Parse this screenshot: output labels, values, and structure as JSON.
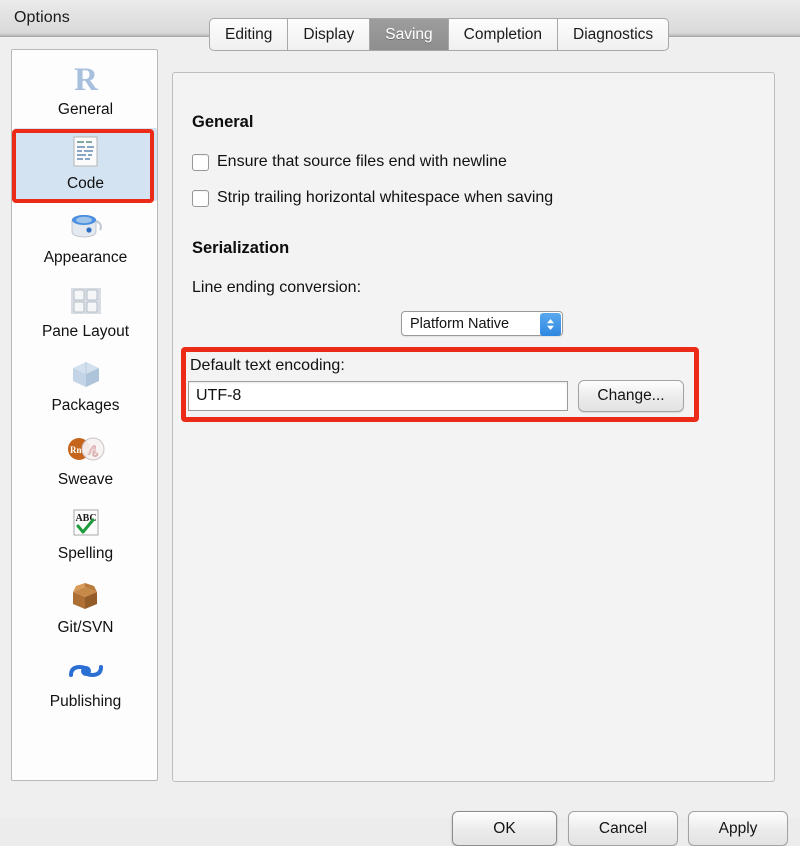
{
  "window": {
    "title": "Options"
  },
  "sidebar": {
    "items": [
      {
        "label": "General",
        "icon": "r-logo-icon",
        "selected": false
      },
      {
        "label": "Code",
        "icon": "code-file-icon",
        "selected": true
      },
      {
        "label": "Appearance",
        "icon": "paint-can-icon",
        "selected": false
      },
      {
        "label": "Pane Layout",
        "icon": "grid-panes-icon",
        "selected": false
      },
      {
        "label": "Packages",
        "icon": "box-icon",
        "selected": false
      },
      {
        "label": "Sweave",
        "icon": "rnw-pdf-icon",
        "selected": false
      },
      {
        "label": "Spelling",
        "icon": "abc-check-icon",
        "selected": false
      },
      {
        "label": "Git/SVN",
        "icon": "open-box-icon",
        "selected": false
      },
      {
        "label": "Publishing",
        "icon": "publish-icon",
        "selected": false
      }
    ]
  },
  "tabs": [
    {
      "label": "Editing",
      "active": false
    },
    {
      "label": "Display",
      "active": false
    },
    {
      "label": "Saving",
      "active": true
    },
    {
      "label": "Completion",
      "active": false
    },
    {
      "label": "Diagnostics",
      "active": false
    }
  ],
  "panel": {
    "general": {
      "heading": "General",
      "checkboxes": [
        {
          "label": "Ensure that source files end with newline",
          "checked": false
        },
        {
          "label": "Strip trailing horizontal whitespace when saving",
          "checked": false
        }
      ]
    },
    "serialization": {
      "heading": "Serialization",
      "line_ending": {
        "label": "Line ending conversion:",
        "value": "Platform Native"
      },
      "encoding": {
        "label": "Default text encoding:",
        "value": "UTF-8",
        "change_button": "Change..."
      }
    }
  },
  "footer": {
    "ok": "OK",
    "cancel": "Cancel",
    "apply": "Apply"
  },
  "colors": {
    "highlight": "#ec2a18",
    "selected_item": "#d3e3f2",
    "active_tab": "#9d9d9d",
    "stepper_blue": "#2e87e0"
  }
}
